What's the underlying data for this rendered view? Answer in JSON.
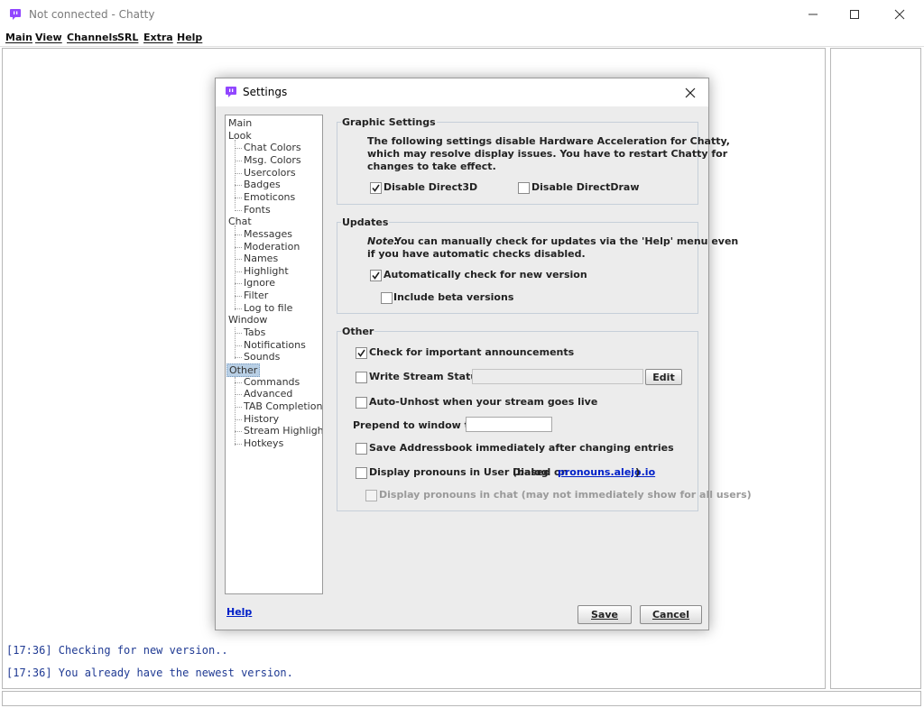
{
  "window": {
    "title": "Not connected - Chatty",
    "icon": "chatty-bubble-icon",
    "controls": [
      "minimize-icon",
      "maximize-icon",
      "close-icon"
    ]
  },
  "menu": {
    "items": [
      "Main",
      "View",
      "Channels",
      "SRL",
      "Extra",
      "Help"
    ]
  },
  "chat": {
    "lines": [
      "[17:36] Checking for new version..",
      "[17:36] You already have the newest version."
    ]
  },
  "settings": {
    "title": "Settings",
    "tree": [
      {
        "label": "Main",
        "level": 0
      },
      {
        "label": "Look",
        "level": 0
      },
      {
        "label": "Chat Colors",
        "level": 1
      },
      {
        "label": "Msg. Colors",
        "level": 1
      },
      {
        "label": "Usercolors",
        "level": 1
      },
      {
        "label": "Badges",
        "level": 1
      },
      {
        "label": "Emoticons",
        "level": 1
      },
      {
        "label": "Fonts",
        "level": 1
      },
      {
        "label": "Chat",
        "level": 0
      },
      {
        "label": "Messages",
        "level": 1
      },
      {
        "label": "Moderation",
        "level": 1
      },
      {
        "label": "Names",
        "level": 1
      },
      {
        "label": "Highlight",
        "level": 1
      },
      {
        "label": "Ignore",
        "level": 1
      },
      {
        "label": "Filter",
        "level": 1
      },
      {
        "label": "Log to file",
        "level": 1
      },
      {
        "label": "Window",
        "level": 0
      },
      {
        "label": "Tabs",
        "level": 1
      },
      {
        "label": "Notifications",
        "level": 1
      },
      {
        "label": "Sounds",
        "level": 1
      },
      {
        "label": "Other",
        "level": 0,
        "selected": true
      },
      {
        "label": "Commands",
        "level": 1
      },
      {
        "label": "Advanced",
        "level": 1
      },
      {
        "label": "TAB Completion",
        "level": 1
      },
      {
        "label": "History",
        "level": 1
      },
      {
        "label": "Stream Highlights",
        "level": 1
      },
      {
        "label": "Hotkeys",
        "level": 1
      }
    ],
    "graphic": {
      "title": "Graphic Settings",
      "desc_line1": "The following settings disable Hardware Acceleration for Chatty,",
      "desc_line2": "which may resolve display issues. You have to restart Chatty for",
      "desc_line3": "changes to take effect.",
      "disable_direct3d": {
        "label": "Disable Direct3D",
        "checked": true
      },
      "disable_directdraw": {
        "label": "Disable DirectDraw",
        "checked": false
      }
    },
    "updates": {
      "title": "Updates",
      "note_label": "Note:",
      "note_line1": "You can manually check for updates via the 'Help' menu even",
      "note_line2": "if you have automatic checks disabled.",
      "auto_check": {
        "label": "Automatically check for new version",
        "checked": true
      },
      "beta": {
        "label": "Include beta versions",
        "checked": false
      }
    },
    "other": {
      "title": "Other",
      "announcements": {
        "label": "Check for important announcements",
        "checked": true
      },
      "stream_status": {
        "label": "Write Stream Status:",
        "checked": false,
        "value": ""
      },
      "edit_label": "Edit",
      "auto_unhost": {
        "label": "Auto-Unhost when your stream goes live",
        "checked": false
      },
      "prepend_label": "Prepend to window title:",
      "prepend_value": "",
      "addressbook": {
        "label": "Save Addressbook immediately after changing entries",
        "checked": false
      },
      "pronouns": {
        "label": "Display pronouns in User Dialog",
        "based_on": "(based on",
        "link": "pronouns.alejo.io",
        "close_paren": ")",
        "checked": false
      },
      "pronouns_chat": {
        "label": "Display pronouns in chat (may not immediately show for all users)",
        "checked": false,
        "disabled": true
      }
    },
    "help_link": "Help",
    "save_label": "Save",
    "cancel_label": "Cancel"
  },
  "colors": {
    "chat_text": "#1f3a93",
    "link": "#0020c8",
    "tree_selection": "#b8cfe5",
    "icon_purple": "#9146ff"
  }
}
